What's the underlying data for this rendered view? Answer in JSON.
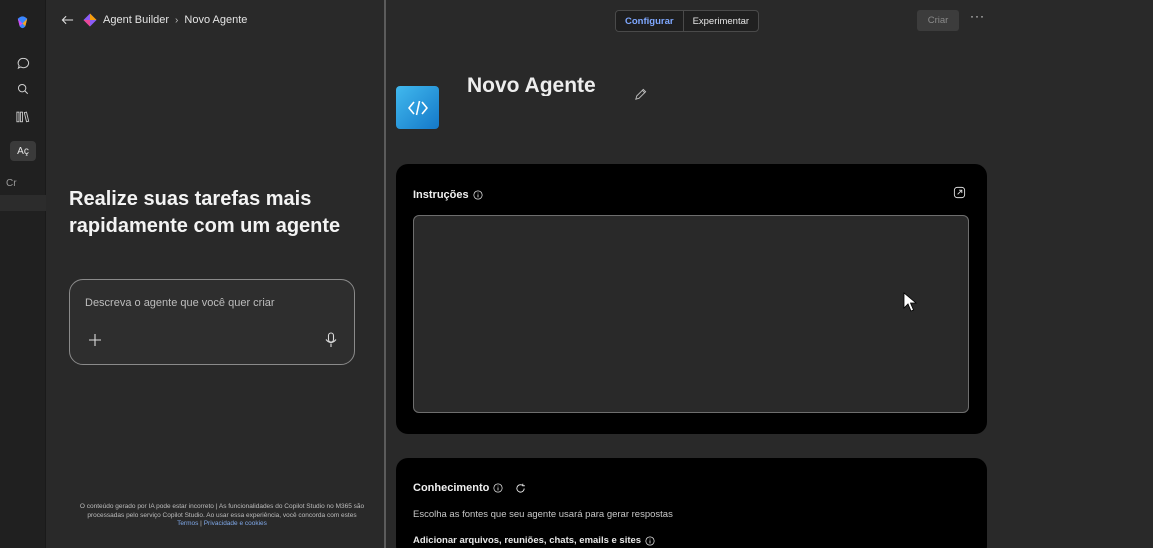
{
  "rail": {
    "chip_label": "Aç",
    "small_label": "Cr"
  },
  "breadcrumb": {
    "root": "Agent Builder",
    "separator": "›",
    "current": "Novo Agente"
  },
  "left_panel": {
    "headline": "Realize suas tarefas mais rapidamente com um agente",
    "prompt_placeholder": "Descreva o agente que você quer criar",
    "disclaimer_text": "O conteúdo gerado por IA pode estar incorreto | As funcionalidades do Copilot Studio no M365 são processadas pelo serviço Copilot Studio. Ao usar essa experiência, você concorda com estes ",
    "link_terms": "Termos",
    "link_sep": " | ",
    "link_privacy": "Privacidade e cookies"
  },
  "topbar": {
    "tabs": [
      {
        "label": "Configurar",
        "active": true
      },
      {
        "label": "Experimentar",
        "active": false
      }
    ],
    "create_label": "Criar",
    "more_label": "···"
  },
  "agent": {
    "name": "Novo Agente"
  },
  "instructions": {
    "title": "Instruções"
  },
  "knowledge": {
    "title": "Conhecimento",
    "description": "Escolha as fontes que seu agente usará para gerar respostas",
    "subheading": "Adicionar arquivos, reuniões, chats, emails e sites"
  },
  "colors": {
    "accent": "#7fa8ff",
    "agent_icon": "#2a9ee0",
    "background": "#292929",
    "card": "#000000"
  },
  "icons": [
    "copilot-logo-icon",
    "chat-icon",
    "search-icon",
    "library-icon",
    "back-arrow-icon",
    "agent-builder-icon",
    "plus-icon",
    "microphone-icon",
    "agent-code-icon",
    "pencil-icon",
    "info-icon",
    "expand-icon",
    "refresh-icon",
    "pointer-cursor-icon"
  ]
}
